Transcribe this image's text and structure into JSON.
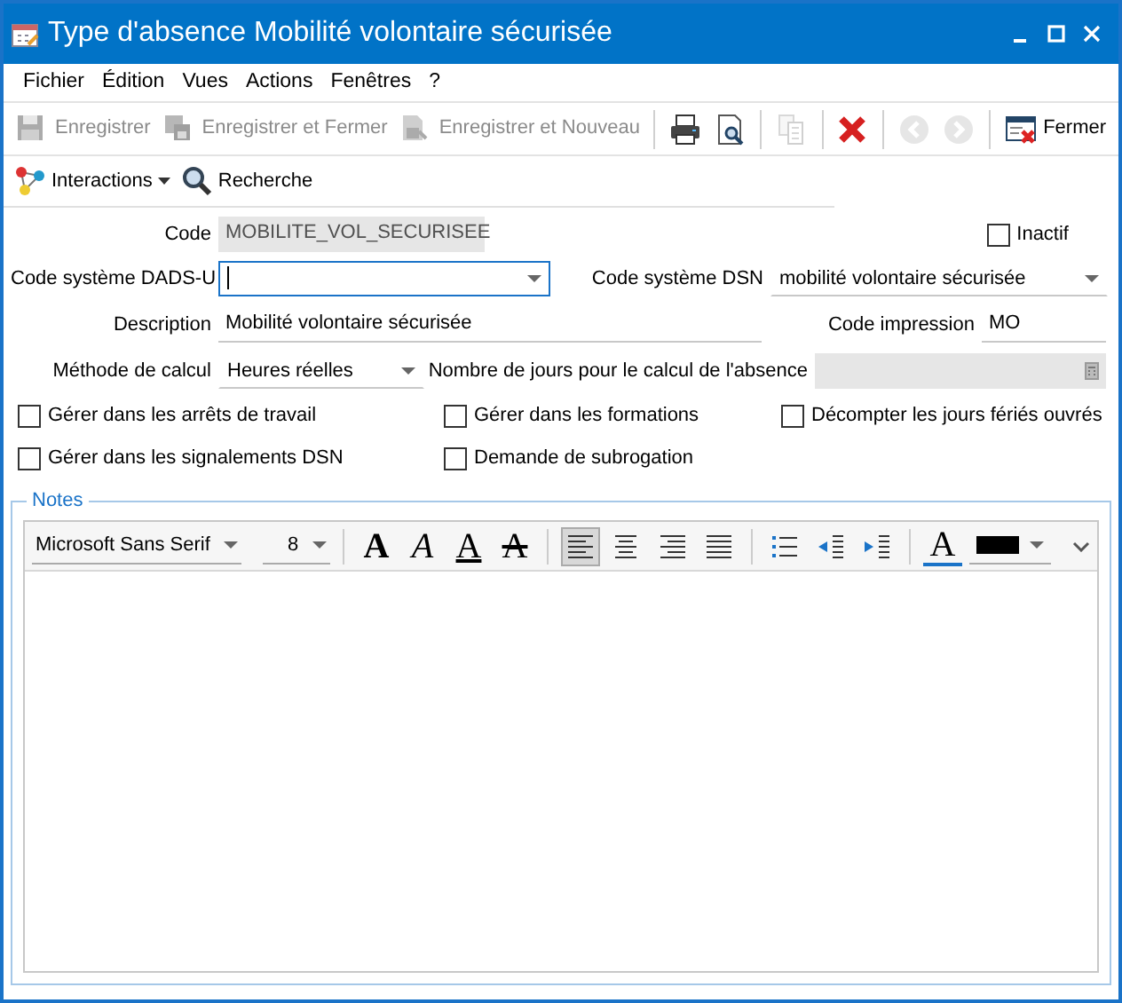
{
  "window": {
    "title": "Type d'absence Mobilité volontaire sécurisée"
  },
  "menu": [
    {
      "label": "Fichier"
    },
    {
      "label": "Édition"
    },
    {
      "label": "Vues"
    },
    {
      "label": "Actions"
    },
    {
      "label": "Fenêtres"
    },
    {
      "label": "?"
    }
  ],
  "toolbar": [
    {
      "kind": "text",
      "label": "Enregistrer",
      "disabled": true
    },
    {
      "kind": "text",
      "label": "Enregistrer et Fermer",
      "disabled": true
    },
    {
      "kind": "text",
      "label": "Enregistrer et Nouveau",
      "disabled": true
    },
    {
      "kind": "separator"
    },
    {
      "kind": "icon",
      "disabled": false
    },
    {
      "kind": "icon",
      "disabled": false
    },
    {
      "kind": "separator"
    },
    {
      "kind": "icon",
      "disabled": true
    },
    {
      "kind": "separator"
    },
    {
      "kind": "icon",
      "disabled": false
    },
    {
      "kind": "separator"
    },
    {
      "kind": "icon",
      "disabled": true
    },
    {
      "kind": "icon",
      "disabled": true
    },
    {
      "kind": "separator"
    },
    {
      "kind": "text",
      "label": "Fermer",
      "disabled": false
    }
  ],
  "toolbar2": [
    {
      "label": "Interactions",
      "dropdown": true
    },
    {
      "label": "Recherche",
      "dropdown": false
    }
  ],
  "form": {
    "code": {
      "label": "Code",
      "value": "MOBILITE_VOL_SECURISEE",
      "disabled": true
    },
    "inactif": {
      "label": "Inactif",
      "checked": false
    },
    "dads": {
      "label": "Code système DADS-U",
      "focused": true
    },
    "dsn": {
      "label": "Code système DSN",
      "value": "mobilité volontaire sécurisée"
    },
    "description": {
      "label": "Description",
      "value": "Mobilité volontaire sécurisée"
    },
    "code_impression": {
      "label": "Code impression",
      "value": "MO"
    },
    "methode": {
      "label": "Méthode de calcul",
      "value": "Heures réelles"
    },
    "nombre_jours": {
      "label": "Nombre de jours pour le calcul de l'absence",
      "disabled": true
    },
    "checkboxes": [
      {
        "label": "Gérer dans les arrêts de travail",
        "checked": false
      },
      {
        "label": "Gérer dans les formations",
        "checked": false
      },
      {
        "label": "Décompter les jours fériés ouvrés",
        "checked": false
      },
      {
        "label": "Gérer dans les signalements DSN",
        "checked": false
      },
      {
        "label": "Demande de subrogation",
        "checked": false
      }
    ]
  },
  "notes": {
    "legend": "Notes",
    "font": "Microsoft Sans Serif",
    "size": "8",
    "format_buttons": [
      {
        "label": "A",
        "kind": "bold"
      },
      {
        "label": "A",
        "kind": "italic"
      },
      {
        "label": "A",
        "kind": "underline"
      },
      {
        "label": "A",
        "kind": "strike"
      }
    ],
    "align_buttons": [
      {
        "kind": "left",
        "selected": true
      },
      {
        "kind": "center",
        "selected": false
      },
      {
        "kind": "right",
        "selected": false
      },
      {
        "kind": "justify",
        "selected": false
      }
    ],
    "color_label": "A",
    "color": "#000000"
  }
}
